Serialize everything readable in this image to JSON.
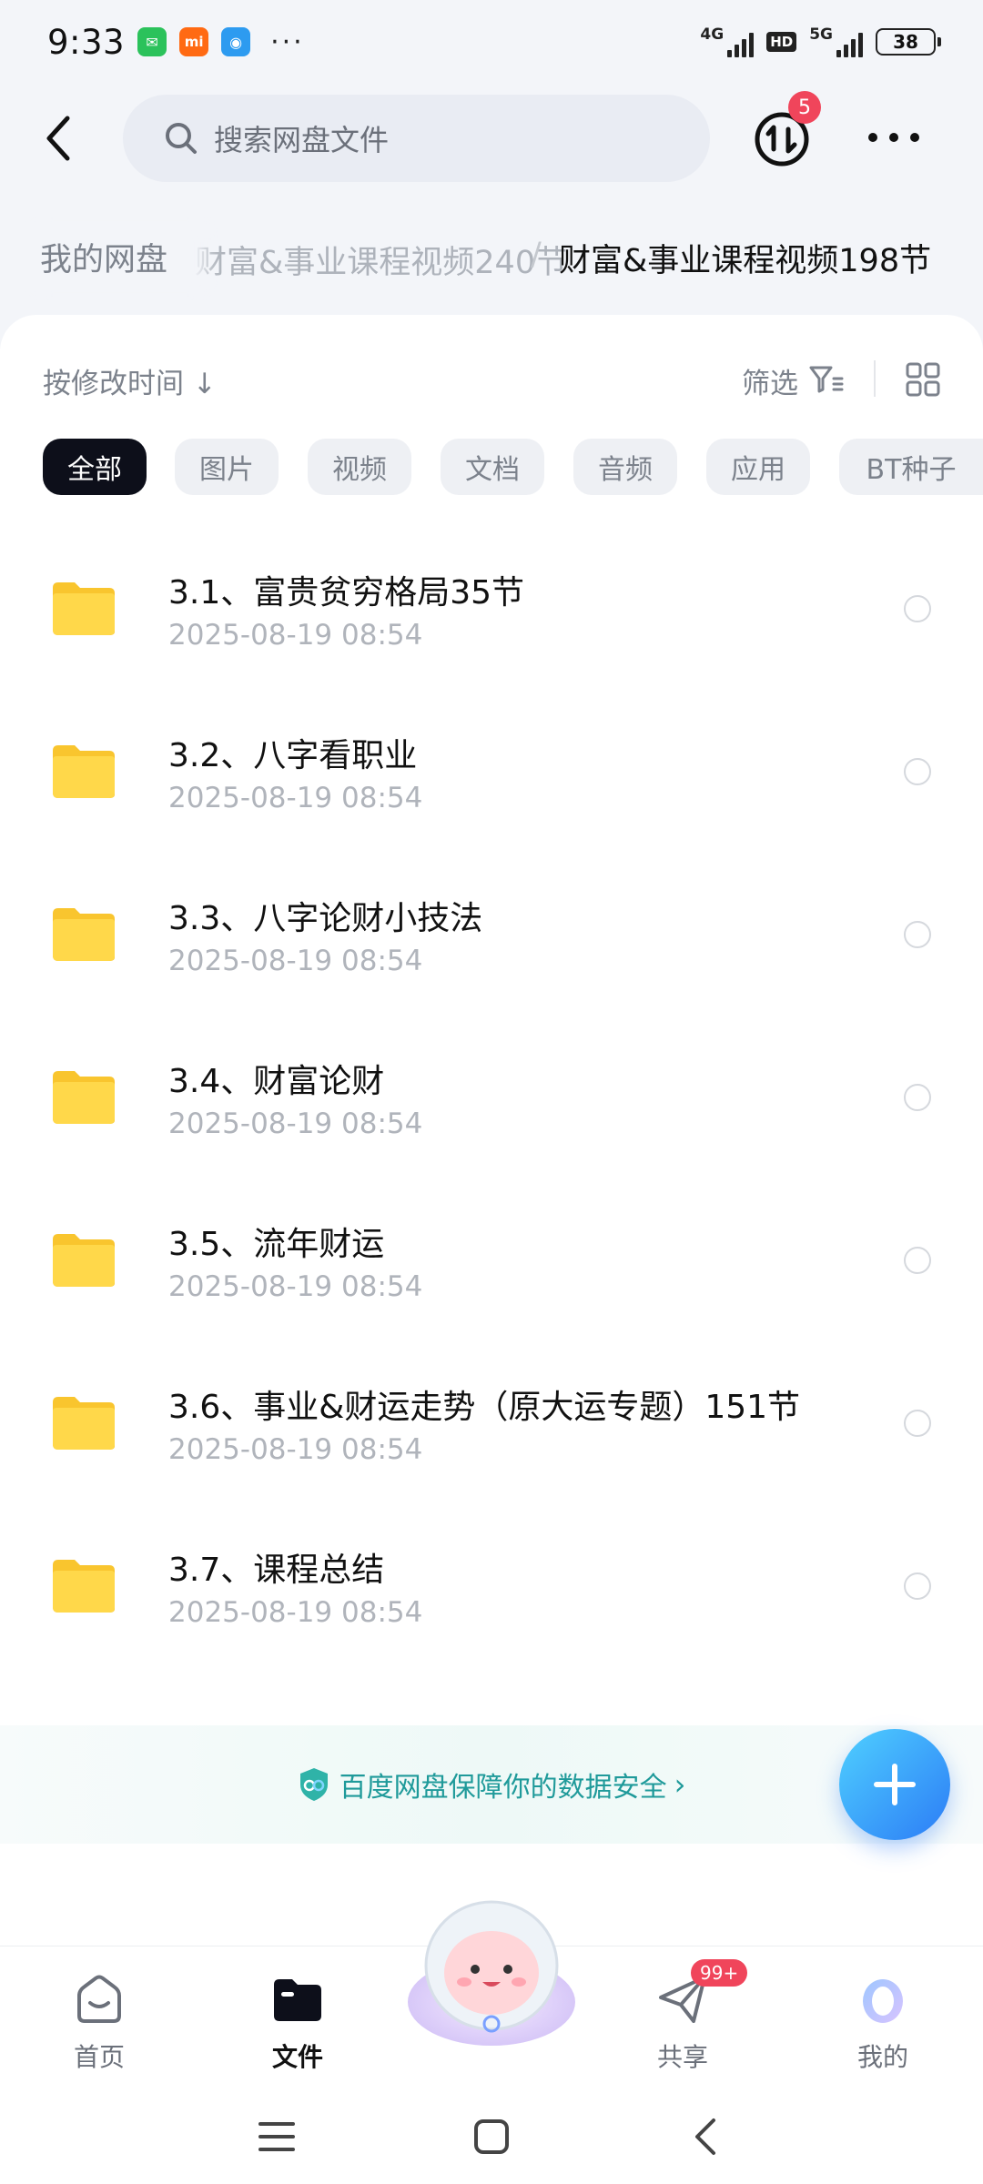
{
  "status_bar": {
    "time": "9:33",
    "apps": [
      {
        "name": "wechat-icon",
        "color": "#2bc25b",
        "glyph": "✉"
      },
      {
        "name": "mi-icon",
        "color": "#ff6a13",
        "glyph": "mi"
      },
      {
        "name": "app-icon",
        "color": "#2d9bf0",
        "glyph": "◉"
      }
    ],
    "overflow": "···",
    "network1": "4G",
    "network2": "5G",
    "hd": "HD",
    "battery": "38"
  },
  "topbar": {
    "search_placeholder": "搜索网盘文件",
    "transfer_badge": "5"
  },
  "breadcrumb": {
    "root": "我的网盘",
    "middle": "财富&事业课程视频240节",
    "separator": "/",
    "current": "财富&事业课程视频198节"
  },
  "toolbar": {
    "sort_label": "按修改时间 ↓",
    "filter_label": "筛选"
  },
  "chips": [
    {
      "label": "全部",
      "active": true
    },
    {
      "label": "图片",
      "active": false
    },
    {
      "label": "视频",
      "active": false
    },
    {
      "label": "文档",
      "active": false
    },
    {
      "label": "音频",
      "active": false
    },
    {
      "label": "应用",
      "active": false
    },
    {
      "label": "BT种子",
      "active": false
    }
  ],
  "files": [
    {
      "name": "3.1、富贵贫穷格局35节",
      "date": "2025-08-19  08:54"
    },
    {
      "name": "3.2、八字看职业",
      "date": "2025-08-19  08:54"
    },
    {
      "name": "3.3、八字论财小技法",
      "date": "2025-08-19  08:54"
    },
    {
      "name": "3.4、财富论财",
      "date": "2025-08-19  08:54"
    },
    {
      "name": "3.5、流年财运",
      "date": "2025-08-19  08:54"
    },
    {
      "name": "3.6、事业&财运走势（原大运专题）151节",
      "date": "2025-08-19  08:54"
    },
    {
      "name": "3.7、课程总结",
      "date": "2025-08-19  08:54"
    }
  ],
  "promo": {
    "text": "百度网盘保障你的数据安全",
    "arrow": "›"
  },
  "bottom_nav": {
    "home": "首页",
    "files": "文件",
    "share": "共享",
    "share_badge": "99+",
    "mine": "我的"
  },
  "colors": {
    "accent": "#2c7cf6",
    "badge": "#f0455b",
    "folder": "#ffd84a",
    "promo": "#1f9a9a"
  }
}
